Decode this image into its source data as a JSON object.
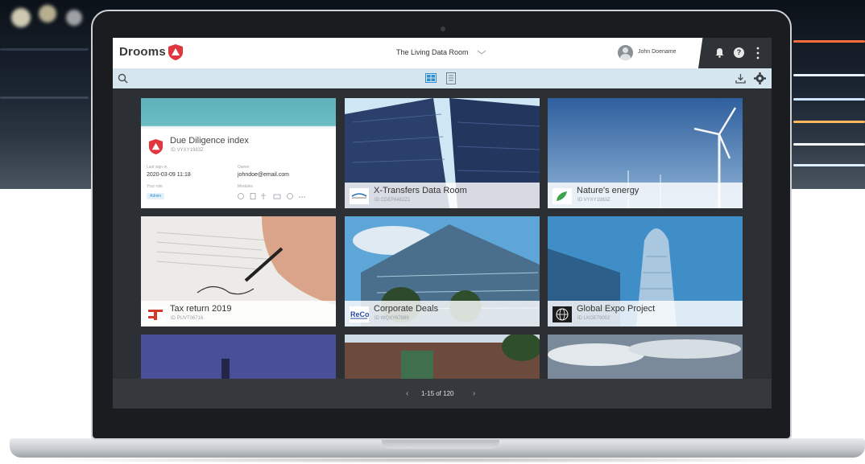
{
  "brand": {
    "name": "Drooms",
    "accent": "#e0373f"
  },
  "header": {
    "room_title": "The Living Data Room",
    "user_name": "John Doename",
    "icons": [
      "bell-icon",
      "help-icon",
      "kebab-menu-icon"
    ],
    "help_glyph": "?"
  },
  "toolbar": {
    "icons": [
      "search-icon",
      "grid-view-icon",
      "list-view-icon",
      "download-icon",
      "settings-icon"
    ]
  },
  "index_card": {
    "title": "Due Diligence index",
    "id": "ID VYXY1983Z",
    "last_sign_in_label": "Last sign-in",
    "last_sign_in": "2020-03-09 11:18",
    "owner_label": "Owner",
    "owner": "johndoe@email.com",
    "role_label": "Your role",
    "role": "Admin",
    "modules_label": "Modules"
  },
  "rooms": [
    {
      "name": "X-Transfers Data Room",
      "id": "ID CDEF6482Z1"
    },
    {
      "name": "Nature's energy",
      "id": "ID VYXY1983Z"
    },
    {
      "name": "Tax return 2019",
      "id": "ID PUVT06716"
    },
    {
      "name": "Corporate Deals",
      "id": "ID WQXY67889"
    },
    {
      "name": "Global Expo Project",
      "id": "ID LKOE79002"
    },
    {
      "name": "",
      "id": ""
    },
    {
      "name": "",
      "id": ""
    },
    {
      "name": "",
      "id": ""
    }
  ],
  "pagination": {
    "prev": "‹",
    "text": "1-15 of 120",
    "next": "›"
  }
}
